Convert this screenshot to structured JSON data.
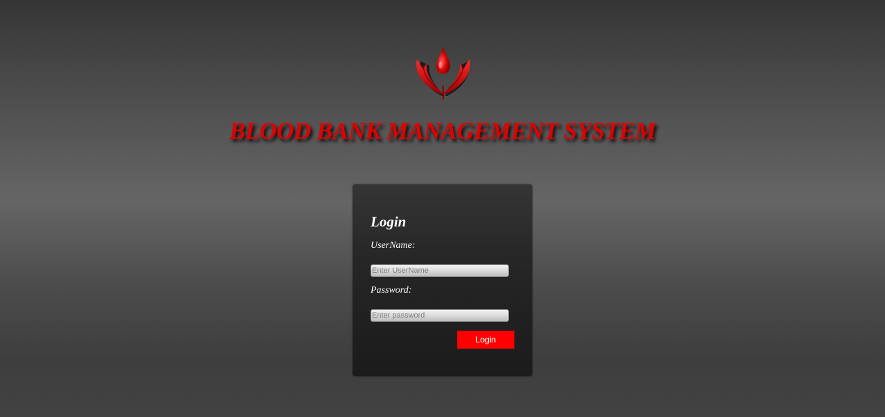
{
  "header": {
    "logo_icon": "blood-drop-hands-icon",
    "title": "BLOOD BANK MANAGEMENT SYSTEM"
  },
  "login": {
    "heading": "Login",
    "username_label": "UserName:",
    "username_placeholder": "Enter UserName",
    "username_value": "",
    "password_label": "Password:",
    "password_placeholder": "Enter password",
    "password_value": "",
    "submit_label": "Login"
  },
  "colors": {
    "accent": "#ff0000",
    "title_red": "#e10000",
    "panel_bg": "#222222"
  }
}
